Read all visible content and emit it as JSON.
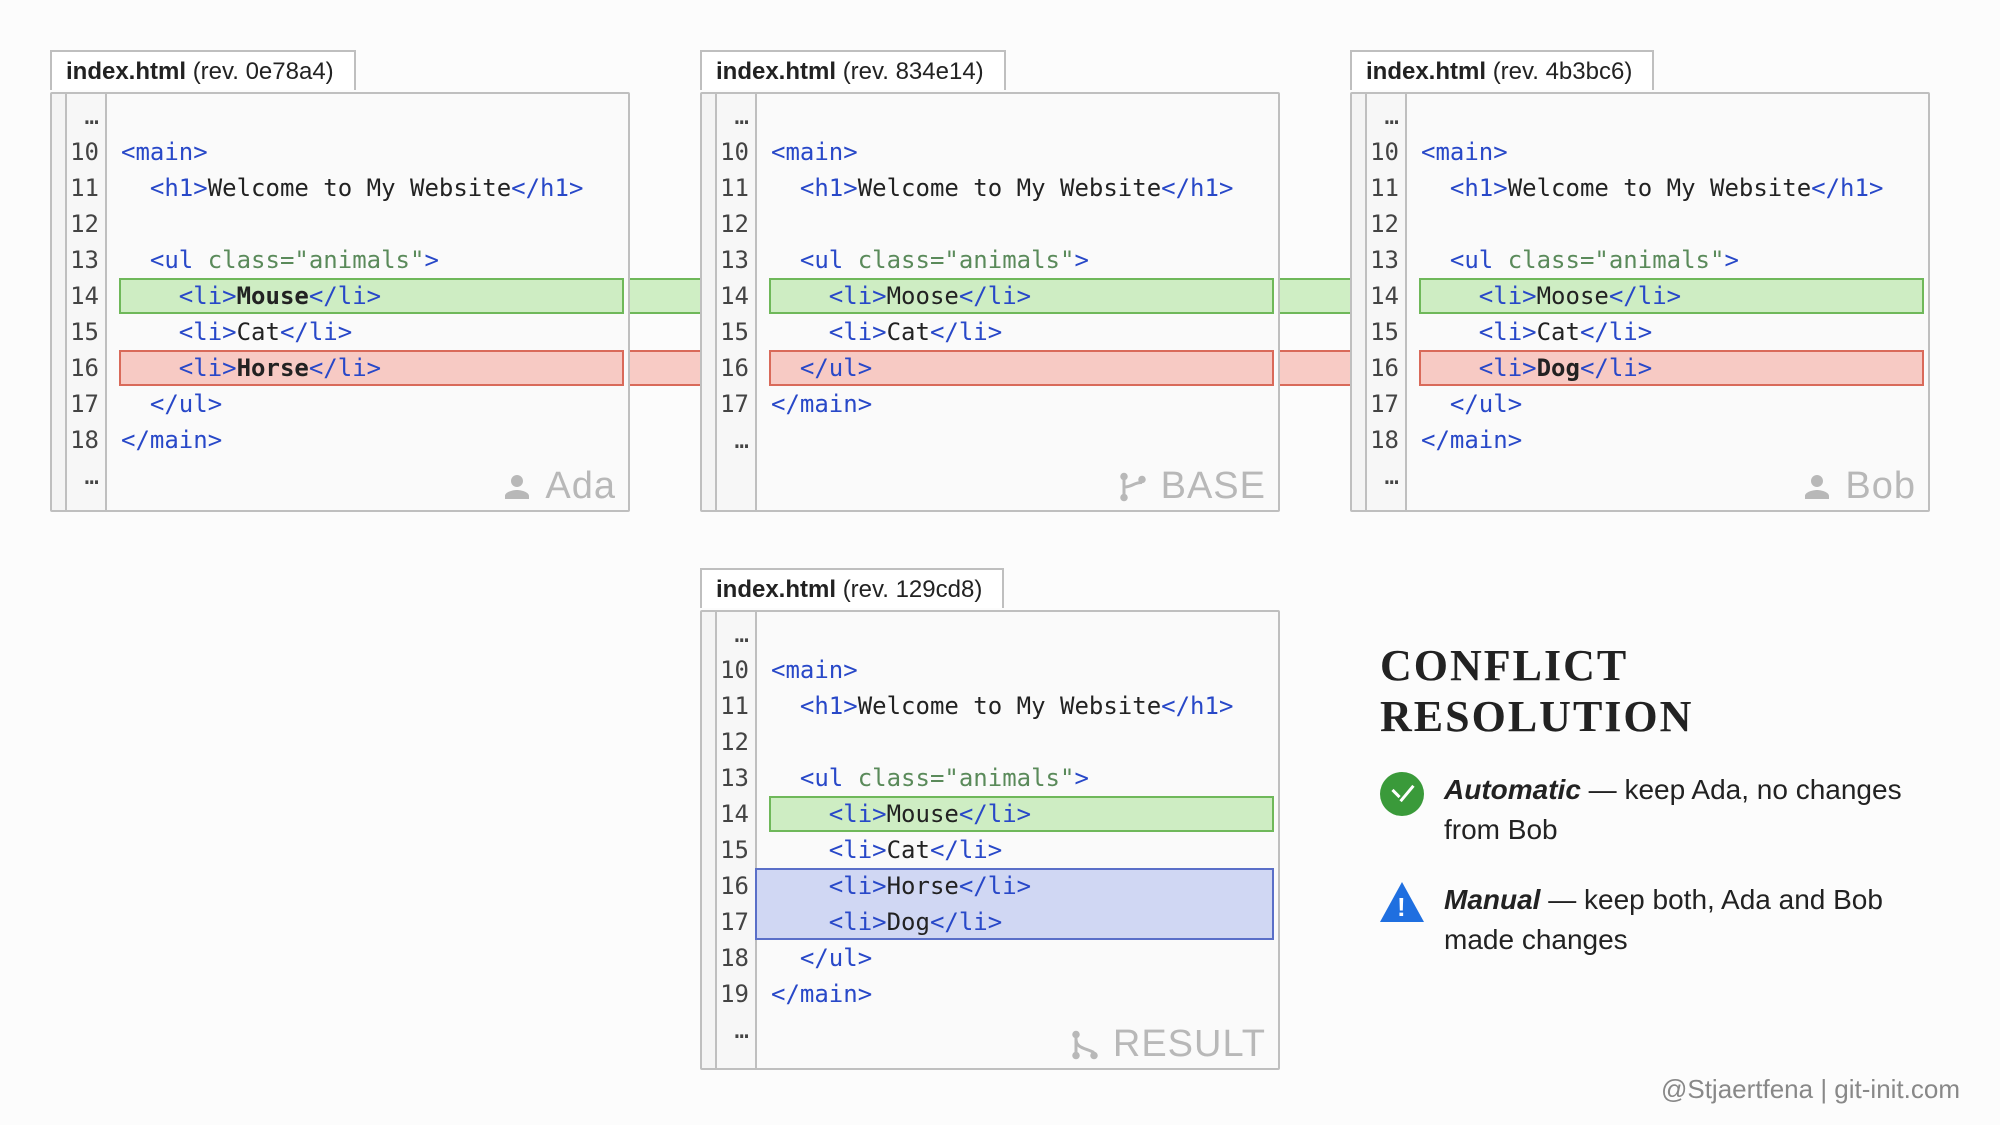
{
  "panels": {
    "ada": {
      "filename": "index.html",
      "rev": "(rev. 0e78a4)",
      "label": "Ada",
      "lines": [
        {
          "num": "…",
          "indent": 0,
          "tokens": []
        },
        {
          "num": "10",
          "indent": 0,
          "tokens": [
            {
              "t": "tag",
              "v": "<main>"
            }
          ]
        },
        {
          "num": "11",
          "indent": 1,
          "tokens": [
            {
              "t": "tag",
              "v": "<h1>"
            },
            {
              "t": "txt",
              "v": "Welcome to My Website"
            },
            {
              "t": "tag",
              "v": "</h1>"
            }
          ]
        },
        {
          "num": "12",
          "indent": 0,
          "tokens": []
        },
        {
          "num": "13",
          "indent": 1,
          "tokens": [
            {
              "t": "tag",
              "v": "<ul "
            },
            {
              "t": "attr",
              "v": "class=\"animals\""
            },
            {
              "t": "tag",
              "v": ">"
            }
          ]
        },
        {
          "num": "14",
          "indent": 2,
          "hl": "green",
          "tokens": [
            {
              "t": "tag",
              "v": "<li>"
            },
            {
              "t": "bold",
              "v": "Mouse"
            },
            {
              "t": "tag",
              "v": "</li>"
            }
          ]
        },
        {
          "num": "15",
          "indent": 2,
          "tokens": [
            {
              "t": "tag",
              "v": "<li>"
            },
            {
              "t": "txt",
              "v": "Cat"
            },
            {
              "t": "tag",
              "v": "</li>"
            }
          ]
        },
        {
          "num": "16",
          "indent": 2,
          "hl": "red",
          "tokens": [
            {
              "t": "tag",
              "v": "<li>"
            },
            {
              "t": "bold",
              "v": "Horse"
            },
            {
              "t": "tag",
              "v": "</li>"
            }
          ]
        },
        {
          "num": "17",
          "indent": 1,
          "tokens": [
            {
              "t": "tag",
              "v": "</ul>"
            }
          ]
        },
        {
          "num": "18",
          "indent": 0,
          "tokens": [
            {
              "t": "tag",
              "v": "</main>"
            }
          ]
        },
        {
          "num": "…",
          "indent": 0,
          "tokens": []
        }
      ]
    },
    "base": {
      "filename": "index.html",
      "rev": "(rev. 834e14)",
      "label": "BASE",
      "lines": [
        {
          "num": "…",
          "indent": 0,
          "tokens": []
        },
        {
          "num": "10",
          "indent": 0,
          "tokens": [
            {
              "t": "tag",
              "v": "<main>"
            }
          ]
        },
        {
          "num": "11",
          "indent": 1,
          "tokens": [
            {
              "t": "tag",
              "v": "<h1>"
            },
            {
              "t": "txt",
              "v": "Welcome to My Website"
            },
            {
              "t": "tag",
              "v": "</h1>"
            }
          ]
        },
        {
          "num": "12",
          "indent": 0,
          "tokens": []
        },
        {
          "num": "13",
          "indent": 1,
          "tokens": [
            {
              "t": "tag",
              "v": "<ul "
            },
            {
              "t": "attr",
              "v": "class=\"animals\""
            },
            {
              "t": "tag",
              "v": ">"
            }
          ]
        },
        {
          "num": "14",
          "indent": 2,
          "hl": "green",
          "tokens": [
            {
              "t": "tag",
              "v": "<li>"
            },
            {
              "t": "txt",
              "v": "Moose"
            },
            {
              "t": "tag",
              "v": "</li>"
            }
          ]
        },
        {
          "num": "15",
          "indent": 2,
          "tokens": [
            {
              "t": "tag",
              "v": "<li>"
            },
            {
              "t": "txt",
              "v": "Cat"
            },
            {
              "t": "tag",
              "v": "</li>"
            }
          ]
        },
        {
          "num": "16",
          "indent": 1,
          "hl": "red",
          "tokens": [
            {
              "t": "tag",
              "v": "</ul>"
            }
          ]
        },
        {
          "num": "17",
          "indent": 0,
          "tokens": [
            {
              "t": "tag",
              "v": "</main>"
            }
          ]
        },
        {
          "num": "…",
          "indent": 0,
          "tokens": []
        }
      ]
    },
    "bob": {
      "filename": "index.html",
      "rev": "(rev. 4b3bc6)",
      "label": "Bob",
      "lines": [
        {
          "num": "…",
          "indent": 0,
          "tokens": []
        },
        {
          "num": "10",
          "indent": 0,
          "tokens": [
            {
              "t": "tag",
              "v": "<main>"
            }
          ]
        },
        {
          "num": "11",
          "indent": 1,
          "tokens": [
            {
              "t": "tag",
              "v": "<h1>"
            },
            {
              "t": "txt",
              "v": "Welcome to My Website"
            },
            {
              "t": "tag",
              "v": "</h1>"
            }
          ]
        },
        {
          "num": "12",
          "indent": 0,
          "tokens": []
        },
        {
          "num": "13",
          "indent": 1,
          "tokens": [
            {
              "t": "tag",
              "v": "<ul "
            },
            {
              "t": "attr",
              "v": "class=\"animals\""
            },
            {
              "t": "tag",
              "v": ">"
            }
          ]
        },
        {
          "num": "14",
          "indent": 2,
          "hl": "green",
          "tokens": [
            {
              "t": "tag",
              "v": "<li>"
            },
            {
              "t": "txt",
              "v": "Moose"
            },
            {
              "t": "tag",
              "v": "</li>"
            }
          ]
        },
        {
          "num": "15",
          "indent": 2,
          "tokens": [
            {
              "t": "tag",
              "v": "<li>"
            },
            {
              "t": "txt",
              "v": "Cat"
            },
            {
              "t": "tag",
              "v": "</li>"
            }
          ]
        },
        {
          "num": "16",
          "indent": 2,
          "hl": "red",
          "tokens": [
            {
              "t": "tag",
              "v": "<li>"
            },
            {
              "t": "bold",
              "v": "Dog"
            },
            {
              "t": "tag",
              "v": "</li>"
            }
          ]
        },
        {
          "num": "17",
          "indent": 1,
          "tokens": [
            {
              "t": "tag",
              "v": "</ul>"
            }
          ]
        },
        {
          "num": "18",
          "indent": 0,
          "tokens": [
            {
              "t": "tag",
              "v": "</main>"
            }
          ]
        },
        {
          "num": "…",
          "indent": 0,
          "tokens": []
        }
      ]
    },
    "result": {
      "filename": "index.html",
      "rev": "(rev. 129cd8)",
      "label": "RESULT",
      "lines": [
        {
          "num": "…",
          "indent": 0,
          "tokens": []
        },
        {
          "num": "10",
          "indent": 0,
          "tokens": [
            {
              "t": "tag",
              "v": "<main>"
            }
          ]
        },
        {
          "num": "11",
          "indent": 1,
          "tokens": [
            {
              "t": "tag",
              "v": "<h1>"
            },
            {
              "t": "txt",
              "v": "Welcome to My Website"
            },
            {
              "t": "tag",
              "v": "</h1>"
            }
          ]
        },
        {
          "num": "12",
          "indent": 0,
          "tokens": []
        },
        {
          "num": "13",
          "indent": 1,
          "tokens": [
            {
              "t": "tag",
              "v": "<ul "
            },
            {
              "t": "attr",
              "v": "class=\"animals\""
            },
            {
              "t": "tag",
              "v": ">"
            }
          ]
        },
        {
          "num": "14",
          "indent": 2,
          "hl": "green",
          "tokens": [
            {
              "t": "tag",
              "v": "<li>"
            },
            {
              "t": "txt",
              "v": "Mouse"
            },
            {
              "t": "tag",
              "v": "</li>"
            }
          ]
        },
        {
          "num": "15",
          "indent": 2,
          "tokens": [
            {
              "t": "tag",
              "v": "<li>"
            },
            {
              "t": "txt",
              "v": "Cat"
            },
            {
              "t": "tag",
              "v": "</li>"
            }
          ]
        },
        {
          "num": "16",
          "indent": 2,
          "hl": "blue",
          "tokens": [
            {
              "t": "tag",
              "v": "<li>"
            },
            {
              "t": "txt",
              "v": "Horse"
            },
            {
              "t": "tag",
              "v": "</li>"
            }
          ]
        },
        {
          "num": "17",
          "indent": 2,
          "hl": "blue-cont",
          "tokens": [
            {
              "t": "tag",
              "v": "<li>"
            },
            {
              "t": "txt",
              "v": "Dog"
            },
            {
              "t": "tag",
              "v": "</li>"
            }
          ]
        },
        {
          "num": "18",
          "indent": 1,
          "tokens": [
            {
              "t": "tag",
              "v": "</ul>"
            }
          ]
        },
        {
          "num": "19",
          "indent": 0,
          "tokens": [
            {
              "t": "tag",
              "v": "</main>"
            }
          ]
        },
        {
          "num": "…",
          "indent": 0,
          "tokens": []
        }
      ]
    }
  },
  "legend": {
    "title": "Conflict resolution",
    "automatic": {
      "label": "Automatic",
      "desc": " — keep Ada, no changes from Bob"
    },
    "manual": {
      "label": "Manual",
      "desc": " — keep both, Ada and Bob made changes"
    }
  },
  "credit": "@Stjaertfena | git-init.com",
  "colors": {
    "green": "#6fb85a",
    "red": "#d96a5a",
    "blue": "#5a6fc8"
  }
}
